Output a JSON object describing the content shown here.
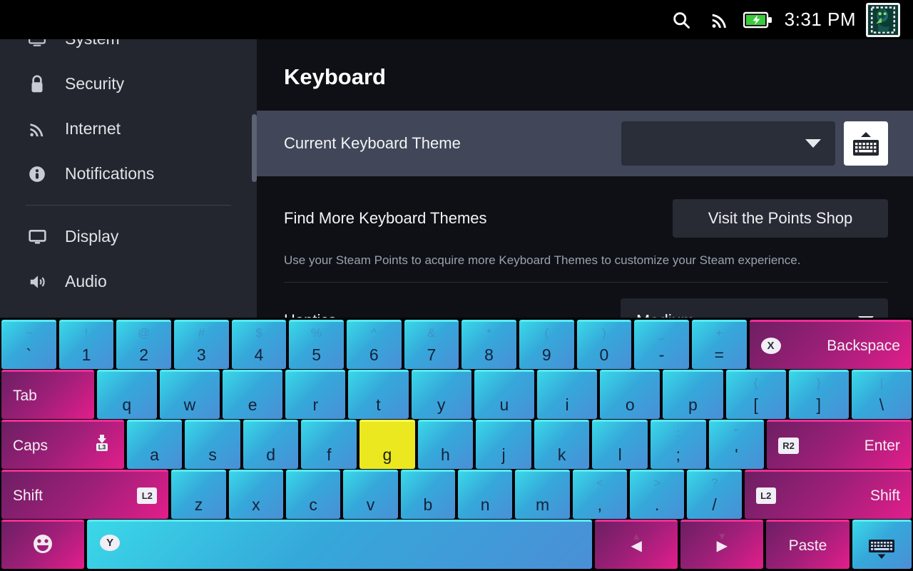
{
  "topbar": {
    "search_icon": "search-icon",
    "wifi_icon": "wifi-icon",
    "battery_icon": "battery-charging-icon",
    "time": "3:31 PM",
    "avatar": "user-avatar"
  },
  "sidebar": {
    "items": [
      {
        "label": "System",
        "icon": "system-icon"
      },
      {
        "label": "Security",
        "icon": "lock-icon"
      },
      {
        "label": "Internet",
        "icon": "wifi-icon"
      },
      {
        "label": "Notifications",
        "icon": "notification-icon"
      },
      {
        "label": "Display",
        "icon": "monitor-icon"
      },
      {
        "label": "Audio",
        "icon": "speaker-icon"
      }
    ]
  },
  "main": {
    "title": "Keyboard",
    "theme_row": {
      "label": "Current Keyboard Theme",
      "selected_value": "",
      "dropdown_icon": "chevron-down-icon",
      "preview_button_icon": "show-keyboard-icon"
    },
    "themes_row": {
      "label": "Find More Keyboard Themes",
      "button_label": "Visit the Points Shop",
      "description": "Use your Steam Points to acquire more Keyboard Themes to customize your Steam experience."
    },
    "haptics_row": {
      "label": "Haptics",
      "selected_value": "Medium",
      "dropdown_icon": "chevron-down-icon"
    }
  },
  "keyboard": {
    "selected_key": "g",
    "rows": [
      {
        "name": "number-row",
        "keys": [
          {
            "main": "`",
            "shift": "~"
          },
          {
            "main": "1",
            "shift": "!"
          },
          {
            "main": "2",
            "shift": "@"
          },
          {
            "main": "3",
            "shift": "#"
          },
          {
            "main": "4",
            "shift": "$"
          },
          {
            "main": "5",
            "shift": "%"
          },
          {
            "main": "6",
            "shift": "^"
          },
          {
            "main": "7",
            "shift": "&"
          },
          {
            "main": "8",
            "shift": "*"
          },
          {
            "main": "9",
            "shift": "("
          },
          {
            "main": "0",
            "shift": ")"
          },
          {
            "main": "-",
            "shift": "_"
          },
          {
            "main": "=",
            "shift": "+"
          },
          {
            "main": "Backspace",
            "badge": "X",
            "mod": true,
            "flex": 2.55
          }
        ]
      },
      {
        "name": "qwerty-row",
        "keys": [
          {
            "main": "Tab",
            "mod": true,
            "flex": 1.35
          },
          {
            "main": "q"
          },
          {
            "main": "w"
          },
          {
            "main": "e"
          },
          {
            "main": "r"
          },
          {
            "main": "t"
          },
          {
            "main": "y"
          },
          {
            "main": "u"
          },
          {
            "main": "i"
          },
          {
            "main": "o"
          },
          {
            "main": "p"
          },
          {
            "main": "[",
            "shift": "{"
          },
          {
            "main": "]",
            "shift": "}"
          },
          {
            "main": "\\",
            "shift": "|"
          }
        ]
      },
      {
        "name": "home-row",
        "keys": [
          {
            "main": "Caps",
            "badge": "L3",
            "mod": true,
            "flex": 1.8
          },
          {
            "main": "a"
          },
          {
            "main": "s"
          },
          {
            "main": "d"
          },
          {
            "main": "f"
          },
          {
            "main": "g"
          },
          {
            "main": "h"
          },
          {
            "main": "j"
          },
          {
            "main": "k"
          },
          {
            "main": "l"
          },
          {
            "main": ";",
            "shift": ":"
          },
          {
            "main": "'",
            "shift": "\""
          },
          {
            "main": "Enter",
            "badge": "R2",
            "mod": true,
            "flex": 2.2
          }
        ]
      },
      {
        "name": "shift-row",
        "keys": [
          {
            "main": "Shift",
            "badge": "L2",
            "mod": true,
            "flex": 2.65
          },
          {
            "main": "z"
          },
          {
            "main": "x"
          },
          {
            "main": "c"
          },
          {
            "main": "v"
          },
          {
            "main": "b"
          },
          {
            "main": "n"
          },
          {
            "main": "m"
          },
          {
            "main": ",",
            "shift": "<"
          },
          {
            "main": ".",
            "shift": ">"
          },
          {
            "main": "/",
            "shift": "?"
          },
          {
            "main": "Shift",
            "badge": "L2",
            "mod": true,
            "flex": 2.65
          }
        ]
      },
      {
        "name": "bottom-row",
        "keys": [
          {
            "main": "",
            "icon": "emoji-icon",
            "mod": true,
            "flex": 1.6
          },
          {
            "main": "",
            "badge": "Y",
            "spacebar": true
          },
          {
            "main": "◀",
            "sub": "▲",
            "mod": true,
            "arrow": true,
            "flex": 1.6
          },
          {
            "main": "▶",
            "sub": "▼",
            "mod": true,
            "arrow": true,
            "flex": 1.6
          },
          {
            "main": "Paste",
            "mod": true,
            "flex": 1.6
          },
          {
            "main": "",
            "icon": "hide-keyboard-icon",
            "flex": 1.15
          }
        ]
      }
    ]
  },
  "colors": {
    "accent_cyan": "#3ad8e8",
    "accent_magenta": "#e31e8b",
    "selected_yellow": "#ece81f",
    "sidebar_bg": "#23262e",
    "main_bg": "#0e1015",
    "row_highlight": "#414758"
  }
}
